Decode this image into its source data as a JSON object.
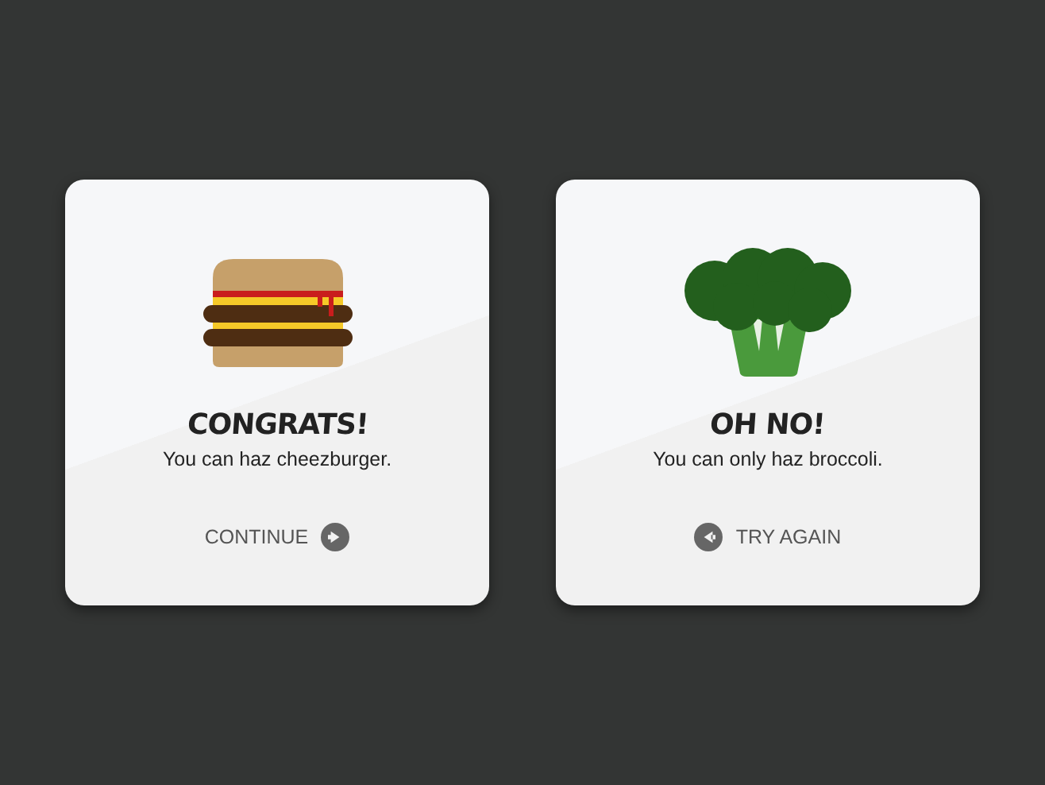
{
  "cards": [
    {
      "kind": "burger",
      "title": "CONGRATS!",
      "message": "You can haz cheezburger.",
      "action": {
        "label": "CONTINUE",
        "icon_first": false
      }
    },
    {
      "kind": "broccoli",
      "title": "OH NO!",
      "message": "You can only haz broccoli.",
      "action": {
        "label": "TRY AGAIN",
        "icon_first": true
      }
    }
  ]
}
